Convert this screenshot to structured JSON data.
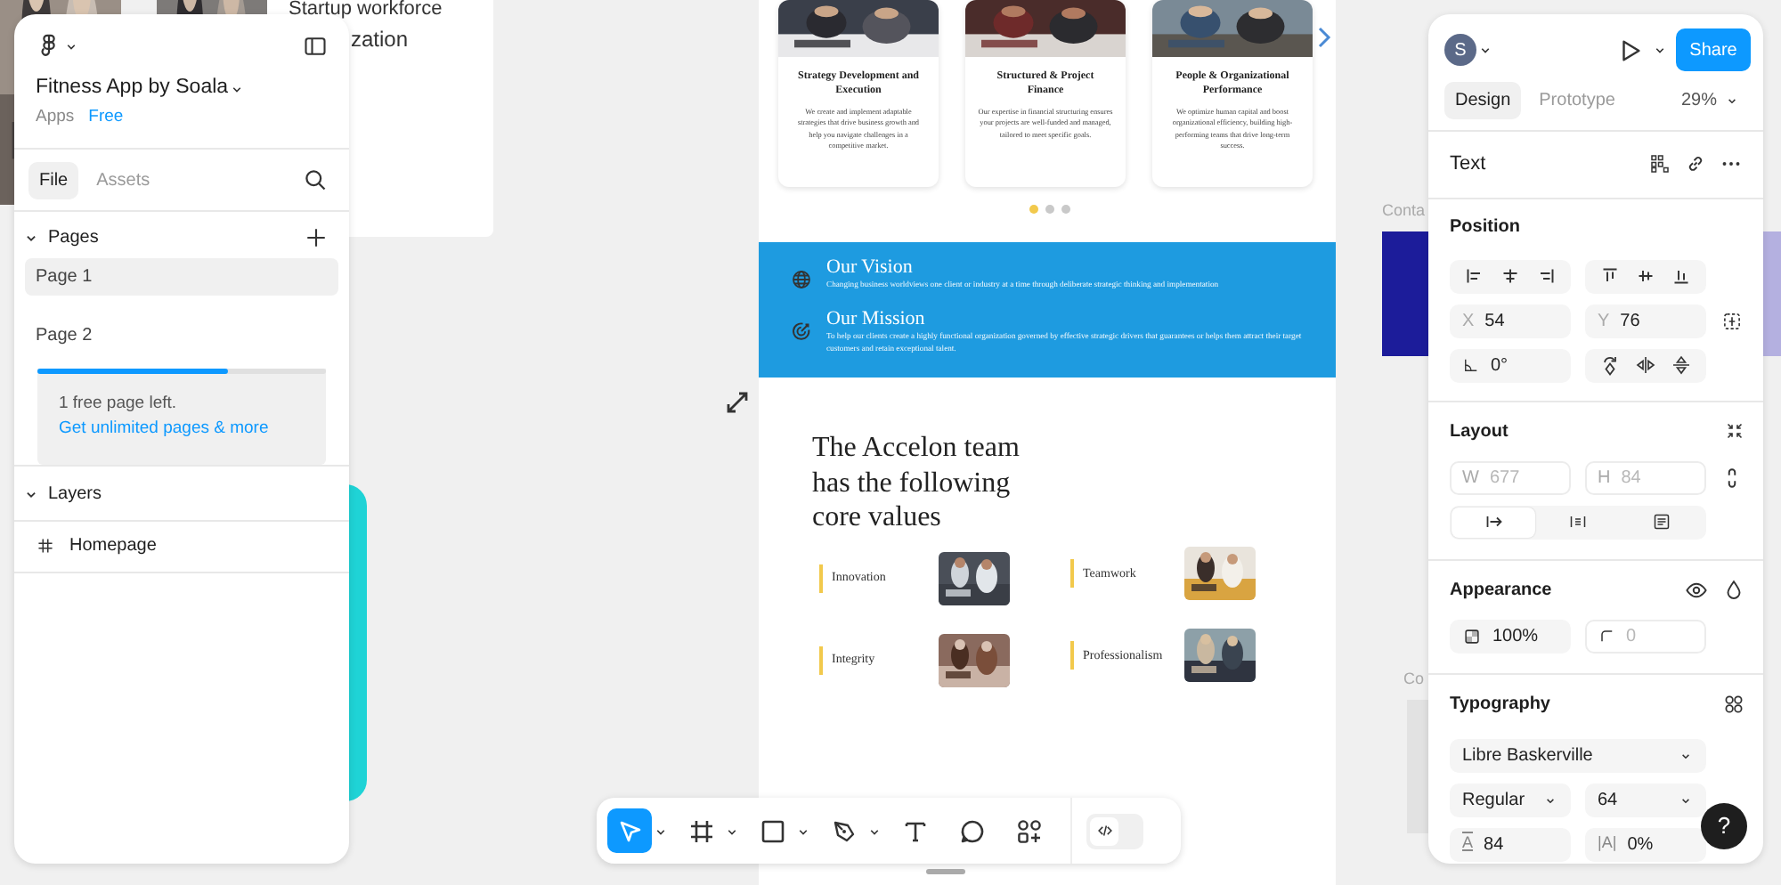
{
  "file": {
    "name": "Fitness App by Soala",
    "team": "Apps",
    "plan": "Free"
  },
  "file_tabs": [
    {
      "label": "File",
      "selected": true
    },
    {
      "label": "Assets",
      "selected": false
    }
  ],
  "pages": {
    "title": "Pages",
    "expanded": true,
    "items": [
      {
        "label": "Page 1",
        "selected": true
      },
      {
        "label": "Page 2",
        "selected": false
      }
    ]
  },
  "upgrade": {
    "level": 0.66,
    "message": "1 free page left.",
    "link": "Get unlimited pages & more"
  },
  "layers": {
    "title": "Layers",
    "expanded": true,
    "items": [
      {
        "label": "Homepage",
        "kind": "frame"
      }
    ]
  },
  "canvas": {
    "background_texts": [
      "Startup workforce",
      "zation"
    ],
    "frame_labels": [
      "Conta",
      "Co"
    ],
    "homepage": {
      "cards": [
        {
          "title": "Strategy Development and Execution",
          "text": "We create and implement adaptable strategies that drive business growth and help you navigate challenges in a competitive market."
        },
        {
          "title": "Structured & Project Finance",
          "text": "Our expertise in financial structuring ensures your projects are well-funded and managed, tailored to meet specific goals."
        },
        {
          "title": "People & Organizational Performance",
          "text": "We optimize human capital and boost organizational efficiency, building high-performing teams that drive long-term success."
        }
      ],
      "carousel_dots": [
        {
          "selected": true
        },
        {
          "selected": false
        },
        {
          "selected": false
        }
      ],
      "statements": [
        {
          "kind": "vision",
          "title": "Our Vision",
          "text": "Changing business worldviews one client or industry at a time through deliberate strategic thinking and implementation"
        },
        {
          "kind": "mission",
          "title": "Our Mission",
          "text": "To help our clients create a highly functional organization governed by effective strategic drivers that guarantees or helps them attract their target customers and retain exceptional talent."
        }
      ],
      "values_title": "The Accelon team has the following core values",
      "values": [
        {
          "label": "Innovation"
        },
        {
          "label": "Teamwork"
        },
        {
          "label": "Integrity"
        },
        {
          "label": "Professionalism"
        }
      ]
    }
  },
  "design_panel": {
    "avatar": "S",
    "share": "Share",
    "tabs": [
      {
        "label": "Design",
        "selected": true
      },
      {
        "label": "Prototype",
        "selected": false
      }
    ],
    "zoom": "29%",
    "layer_type": "Text",
    "position": {
      "title": "Position",
      "x": {
        "label": "X",
        "value": "54",
        "disabled": false
      },
      "y": {
        "label": "Y",
        "value": "76",
        "disabled": false
      },
      "rotation": {
        "value": "0°",
        "disabled": false
      }
    },
    "layout": {
      "title": "Layout",
      "w": {
        "label": "W",
        "value": "677",
        "disabled": true
      },
      "h": {
        "label": "H",
        "value": "84",
        "disabled": true
      },
      "resizing": [
        {
          "kind": "auto-width",
          "selected": true
        },
        {
          "kind": "auto-height",
          "selected": false
        },
        {
          "kind": "fixed",
          "selected": false
        }
      ]
    },
    "appearance": {
      "title": "Appearance",
      "opacity": {
        "value": "100%",
        "disabled": false
      },
      "radius": {
        "value": "0",
        "disabled": true
      }
    },
    "typography": {
      "title": "Typography",
      "font": "Libre Baskerville",
      "weight": "Regular",
      "size": "64",
      "line_height": {
        "icon": "A",
        "value": "84"
      },
      "letter_spacing": {
        "icon": "|A|",
        "value": "0%"
      }
    }
  },
  "toolbar": {
    "tools": [
      {
        "kind": "move",
        "selected": true,
        "has_menu": true
      },
      {
        "kind": "frame",
        "selected": false,
        "has_menu": true
      },
      {
        "kind": "rectangle",
        "selected": false,
        "has_menu": true
      },
      {
        "kind": "pen",
        "selected": false,
        "has_menu": true
      },
      {
        "kind": "text",
        "selected": false,
        "has_menu": false
      },
      {
        "kind": "comment",
        "selected": false,
        "has_menu": false
      },
      {
        "kind": "actions",
        "selected": false,
        "has_menu": false
      }
    ],
    "dev_mode": {
      "on": false
    }
  },
  "help": {
    "label": "?"
  }
}
